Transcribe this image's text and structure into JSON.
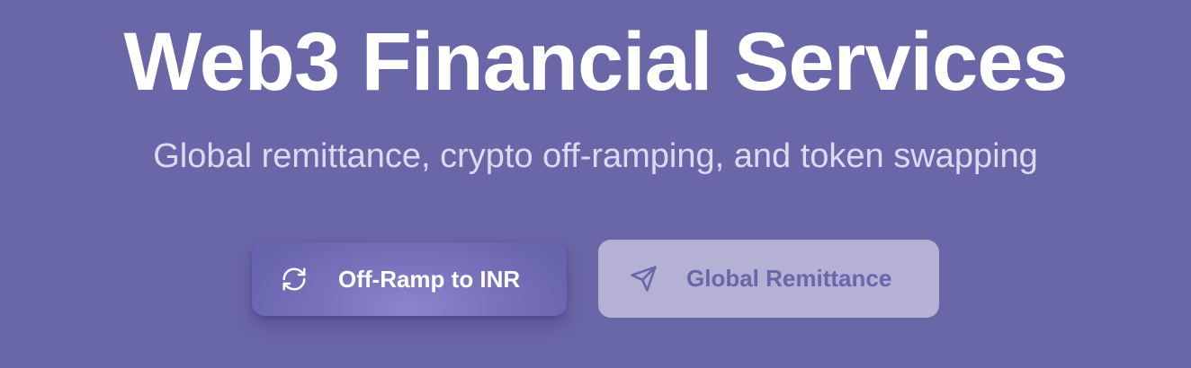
{
  "hero": {
    "title": "Web3 Financial Services",
    "subtitle": "Global remittance, crypto off-ramping, and token swapping"
  },
  "actions": {
    "primary": {
      "label": "Off-Ramp to INR",
      "icon": "refresh-icon"
    },
    "secondary": {
      "label": "Global Remittance",
      "icon": "send-icon"
    }
  },
  "colors": {
    "background": "#6a67a8",
    "title": "#ffffff",
    "subtitle": "#dcdaf0",
    "primary_button": "#7b75be",
    "secondary_button": "#b4b1d4",
    "secondary_text": "#6a66ad"
  }
}
